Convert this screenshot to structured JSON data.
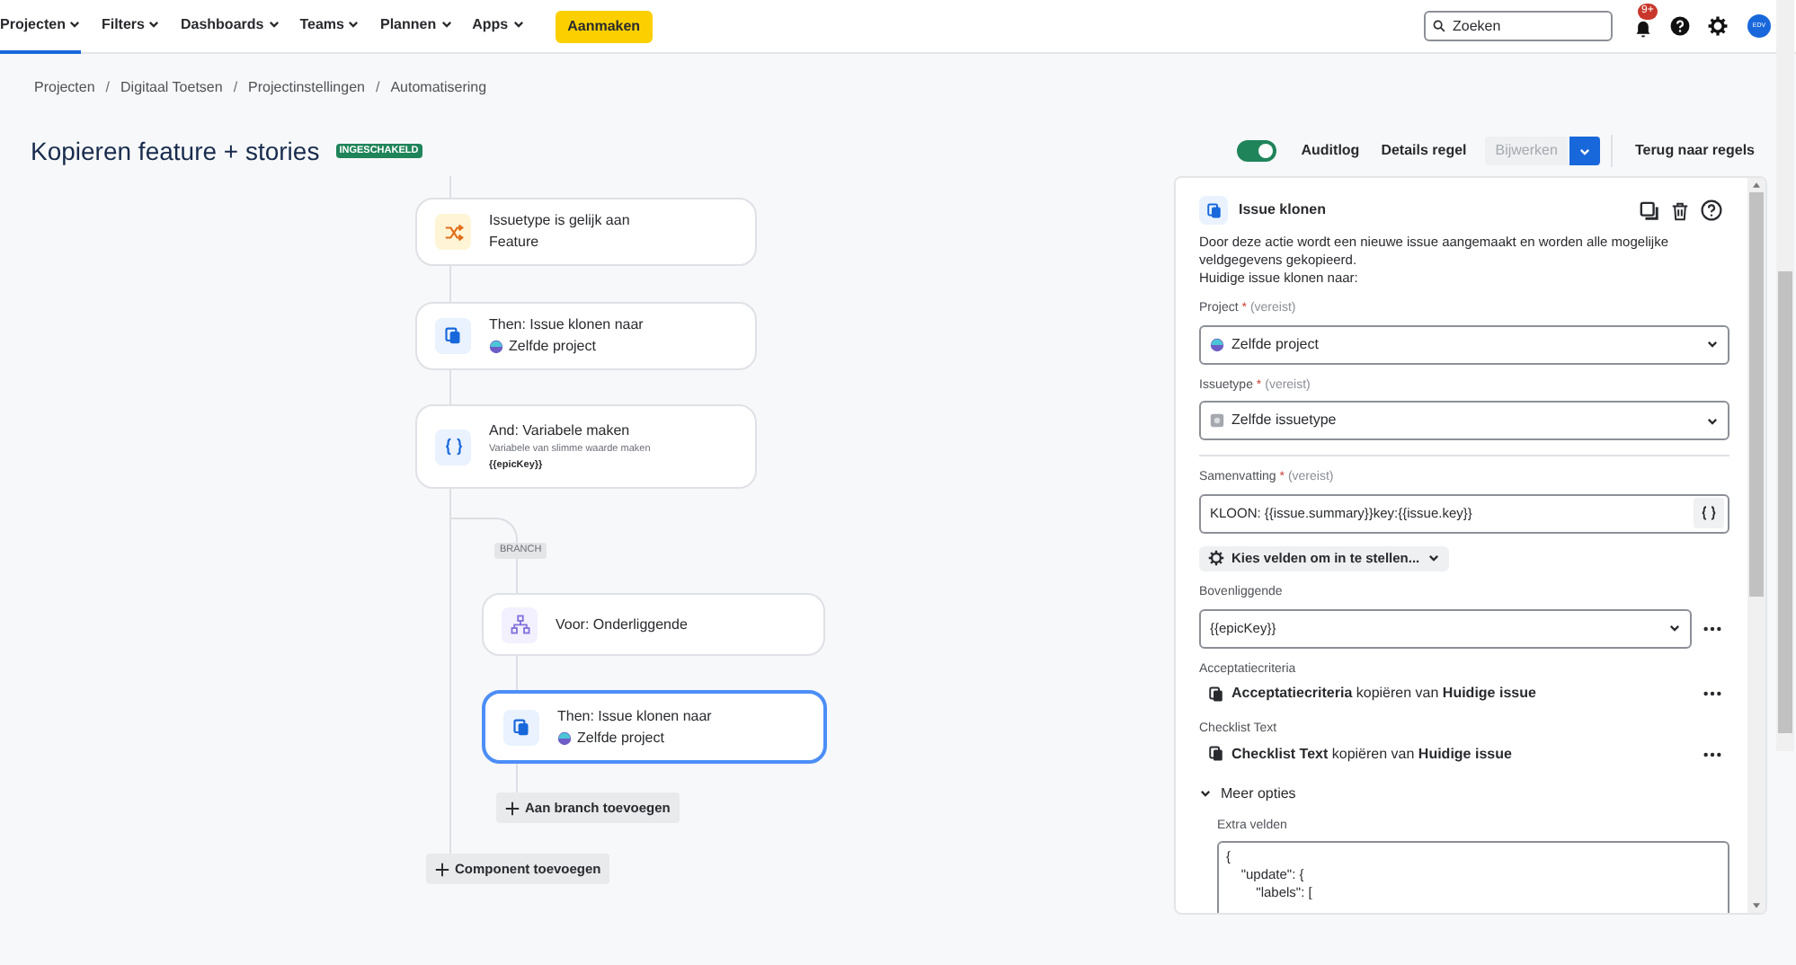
{
  "nav": {
    "items": [
      {
        "label": "Projecten",
        "selected": true
      },
      {
        "label": "Filters",
        "selected": false
      },
      {
        "label": "Dashboards",
        "selected": false
      },
      {
        "label": "Teams",
        "selected": false
      },
      {
        "label": "Plannen",
        "selected": false
      },
      {
        "label": "Apps",
        "selected": false
      }
    ],
    "create": "Aanmaken",
    "search": {
      "placeholder": "Zoeken"
    },
    "notifications": "9+",
    "avatar": "EDV"
  },
  "breadcrumbs": [
    "Projecten",
    "Digitaal Toetsen",
    "Projectinstellingen",
    "Automatisering"
  ],
  "breadcrumb_separator": "/",
  "rule": {
    "title": "Kopieren feature + stories",
    "status": "INGESCHAKELD",
    "enabled": true,
    "actions": [
      {
        "label": "Auditlog",
        "kind": "link"
      },
      {
        "label": "Details regel",
        "kind": "link"
      },
      {
        "label": "Bijwerken",
        "kind": "disabled"
      },
      {
        "label": "Terug naar regels",
        "kind": "link"
      }
    ]
  },
  "flow": {
    "nodes": [
      {
        "kind": "condition",
        "title": "Issuetype is gelijk aan",
        "detail": "Feature",
        "selected": false
      },
      {
        "kind": "clone",
        "title": "Then: Issue klonen naar",
        "project": "Zelfde project",
        "selected": false
      },
      {
        "kind": "variable",
        "title": "And: Variabele maken",
        "detail": "Variabele van slimme waarde maken",
        "value": "{{epicKey}}",
        "selected": false
      }
    ],
    "branch": {
      "label": "BRANCH",
      "nodes": [
        {
          "kind": "branch",
          "title": "Voor: Onderliggende",
          "selected": false
        },
        {
          "kind": "clone",
          "title": "Then: Issue klonen naar",
          "project": "Zelfde project",
          "selected": true
        }
      ],
      "add": "Aan branch toevoegen"
    },
    "add": "Component toevoegen"
  },
  "panel": {
    "title": "Issue klonen",
    "description": "Door deze actie wordt een nieuwe issue aangemaakt en worden alle mogelijke veldgegevens gekopieerd.",
    "subtitle": "Huidige issue klonen naar:",
    "fields": [
      {
        "kind": "select",
        "label": "Project",
        "required_mark": "*",
        "hint": "(vereist)",
        "value": "Zelfde project"
      },
      {
        "kind": "select",
        "label": "Issuetype",
        "required_mark": "*",
        "hint": "(vereist)",
        "value": "Zelfde issuetype"
      },
      {
        "kind": "divider"
      },
      {
        "kind": "smart",
        "label": "Samenvatting",
        "required_mark": "*",
        "hint": "(vereist)",
        "value": "KLOON: {{issue.summary}}key:{{issue.key}}"
      },
      {
        "kind": "choose",
        "value": "Kies velden om in te stellen..."
      },
      {
        "kind": "select-more",
        "label": "Bovenliggende",
        "value": "{{epicKey}}"
      },
      {
        "kind": "copy",
        "label": "Acceptatiecriteria",
        "value": "**Acceptatiecriteria** kopiëren van **Huidige issue**"
      },
      {
        "kind": "copy",
        "label": "Checklist Text",
        "value": "**Checklist Text** kopiëren van **Huidige issue**"
      }
    ],
    "more": {
      "label": "Meer opties",
      "expanded": true,
      "extra_label": "Extra velden",
      "extra_value": "{\n    \"update\": {\n        \"labels\": ["
    }
  }
}
